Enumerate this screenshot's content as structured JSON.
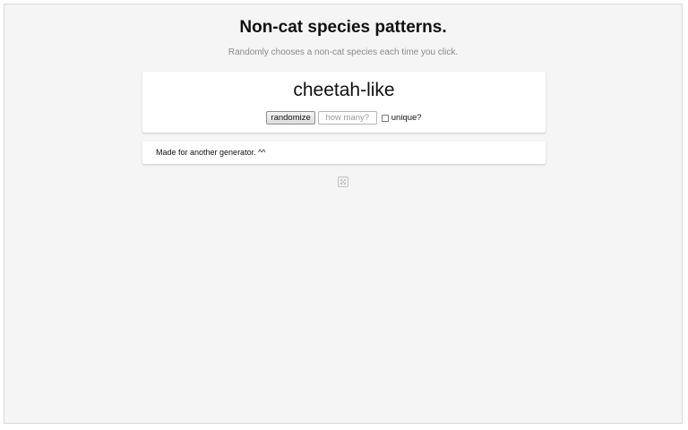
{
  "page": {
    "title": "Non-cat species patterns.",
    "subtitle": "Randomly chooses a non-cat species each time you click."
  },
  "generator": {
    "result": "cheetah-like",
    "randomize_label": "randomize",
    "count_placeholder": "how many?",
    "count_value": "",
    "unique_label": "unique?",
    "unique_checked": false
  },
  "footer": {
    "note": "Made for another generator. ^^"
  },
  "icons": {
    "dice": "dice-icon"
  },
  "colors": {
    "background": "#f5f5f5",
    "card": "#ffffff",
    "subtitle": "#8a8a8a"
  }
}
